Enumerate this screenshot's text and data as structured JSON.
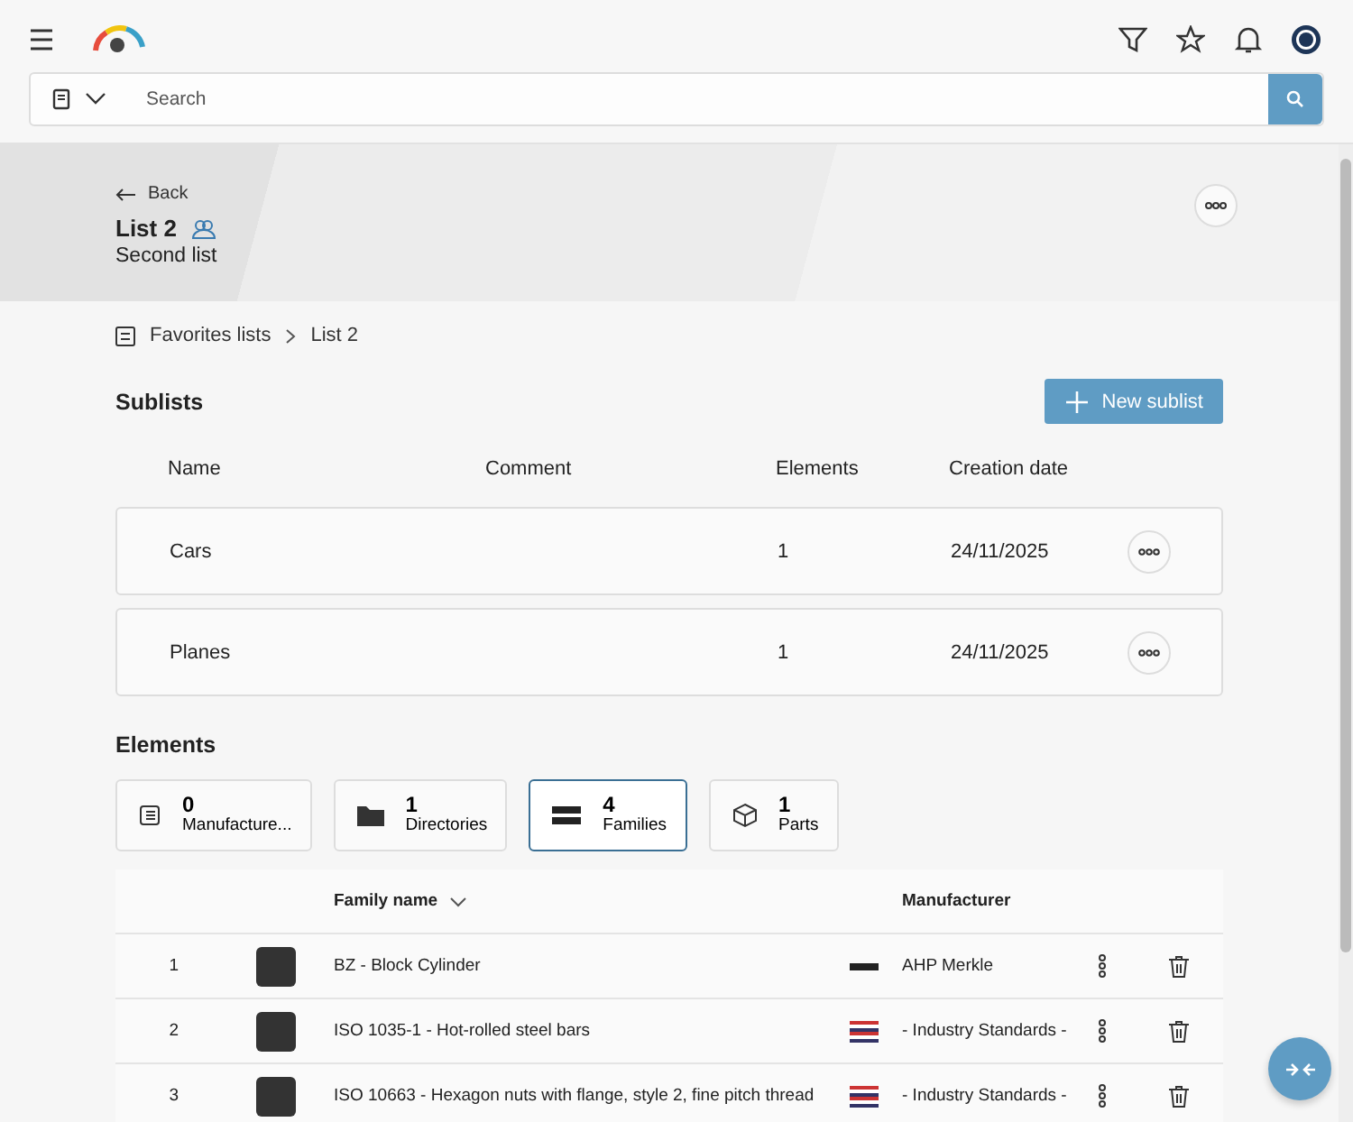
{
  "search": {
    "placeholder": "Search"
  },
  "header": {
    "back": "Back",
    "title": "List 2",
    "subtitle": "Second list"
  },
  "breadcrumb": [
    "Favorites lists",
    "List 2"
  ],
  "sublists": {
    "title": "Sublists",
    "new_button": "New sublist",
    "columns": [
      "Name",
      "Comment",
      "Elements",
      "Creation date"
    ],
    "rows": [
      {
        "name": "Cars",
        "comment": "",
        "elements": "1",
        "date": "24/11/2025"
      },
      {
        "name": "Planes",
        "comment": "",
        "elements": "1",
        "date": "24/11/2025"
      }
    ]
  },
  "elements": {
    "title": "Elements",
    "tabs": [
      {
        "kind": "manufacturers",
        "count": "0",
        "label": "Manufacture...",
        "selected": false
      },
      {
        "kind": "directories",
        "count": "1",
        "label": "Directories",
        "selected": false
      },
      {
        "kind": "families",
        "count": "4",
        "label": "Families",
        "selected": true
      },
      {
        "kind": "parts",
        "count": "1",
        "label": "Parts",
        "selected": false
      }
    ],
    "columns": [
      "Family name",
      "Manufacturer"
    ],
    "rows": [
      {
        "index": "1",
        "name": "BZ - Block Cylinder",
        "manufacturer": "AHP Merkle",
        "kind": "mono"
      },
      {
        "index": "2",
        "name": "ISO 1035-1 - Hot-rolled steel bars",
        "manufacturer": "- Industry Standards -",
        "kind": "flags"
      },
      {
        "index": "3",
        "name": "ISO 10663 - Hexagon nuts with flange, style 2, fine pitch thread",
        "manufacturer": "- Industry Standards -",
        "kind": "flags"
      }
    ]
  }
}
